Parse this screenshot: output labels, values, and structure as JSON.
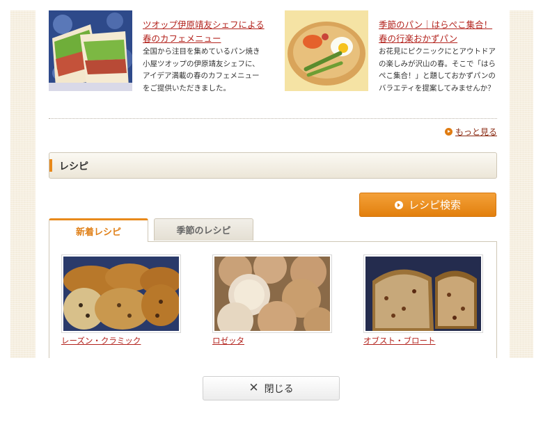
{
  "news": [
    {
      "title": "ツオップ伊原靖友シェフによる春のカフェメニュー",
      "description": "全国から注目を集めているパン焼き小屋ツオップの伊原靖友シェフに、アイデア満載の春のカフェメニューをご提供いただきました。"
    },
    {
      "title": "季節のパン｜はらぺこ集合！春の行楽おかずパン",
      "description": "お花見にピクニックにとアウトドアの楽しみが沢山の春。そこで「はらぺこ集合！」と題しておかずパンのバラエティを提案してみませんか？"
    }
  ],
  "more_link": "もっと見る",
  "recipe_section": {
    "header": "レシピ",
    "search_button": "レシピ検索",
    "tabs": [
      "新着レシピ",
      "季節のレシピ"
    ],
    "items": [
      {
        "name": "レーズン・クラミック"
      },
      {
        "name": "ロゼッタ"
      },
      {
        "name": "オブスト・ブロート"
      }
    ]
  },
  "close_button": "閉じる",
  "colors": {
    "accent": "#e8891b",
    "link": "#b3231d",
    "background": "#f6efe0"
  }
}
